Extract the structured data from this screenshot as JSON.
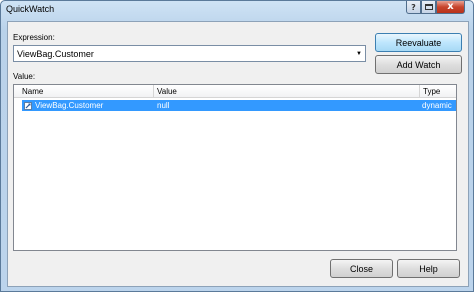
{
  "window": {
    "title": "QuickWatch",
    "caption_help": "?",
    "caption_close": "x"
  },
  "expression": {
    "label": "Expression:",
    "value": "ViewBag.Customer"
  },
  "buttons": {
    "reevaluate": "Reevaluate",
    "add_watch": "Add Watch",
    "close": "Close",
    "help": "Help"
  },
  "value_section": {
    "label": "Value:",
    "columns": [
      "Name",
      "Value",
      "Type"
    ],
    "rows": [
      {
        "name": "ViewBag.Customer",
        "value": "null",
        "type": "dynamic",
        "icon": "property-icon",
        "selected": true
      }
    ]
  },
  "colors": {
    "selection": "#3399ff",
    "client_bg": "#f0f0f0",
    "title_gradient_top": "#cfe3f5"
  }
}
